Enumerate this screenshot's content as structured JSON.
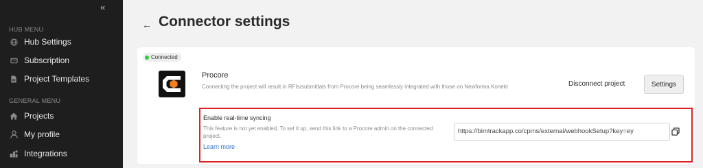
{
  "sidebar": {
    "collapse_glyph": "«",
    "hub_menu_label": "HUB MENU",
    "hub_items": [
      {
        "label": "Hub Settings",
        "icon": "globe-icon"
      },
      {
        "label": "Subscription",
        "icon": "card-icon"
      },
      {
        "label": "Project Templates",
        "icon": "document-icon"
      }
    ],
    "general_menu_label": "GENERAL MENU",
    "general_items": [
      {
        "label": "Projects",
        "icon": "home-icon"
      },
      {
        "label": "My profile",
        "icon": "user-icon"
      },
      {
        "label": "Integrations",
        "icon": "puzzle-icon"
      }
    ]
  },
  "header": {
    "back_glyph": "←",
    "title": "Connector settings"
  },
  "connector": {
    "status": "Connected",
    "status_color": "#2ecc40",
    "name": "Procore",
    "description": "Connecting the project will result in RFIs/submittals from Procore being seamlessly integrated with those on Newforma Konekt",
    "disconnect_label": "Disconnect project",
    "settings_label": "Settings",
    "brand_color": "#f47e20"
  },
  "sync": {
    "title": "Enable real-time syncing",
    "description": "This feature is not yet enabled. To set it up, send this link to a Procore admin on the connected project.",
    "learn_more": "Learn more",
    "url": "https://bimtrackapp.co/cpms/external/webhookSetup?key=ey",
    "highlight_color": "#e02020"
  }
}
